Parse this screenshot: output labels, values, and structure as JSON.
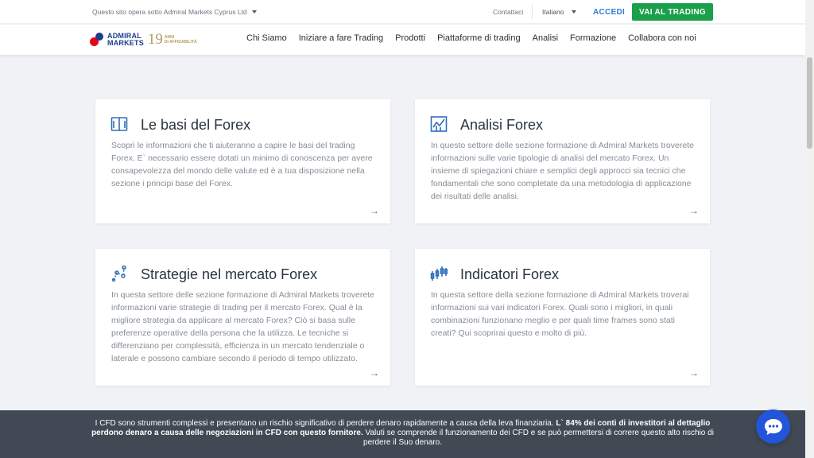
{
  "topbar": {
    "entity_text": "Questo sito opera sotto Admiral Markets Cyprus Ltd",
    "contact": "Contattaci",
    "language": "Italiano",
    "login": "ACCEDI",
    "cta": "VAI AL TRADING"
  },
  "logo": {
    "line1": "ADMIRAL",
    "line2": "MARKETS",
    "years": "19",
    "sub1": "ANNI",
    "sub2": "DI AFFIDABILITÀ"
  },
  "nav": {
    "items": [
      "Chi Siamo",
      "Iniziare a fare Trading",
      "Prodotti",
      "Piattaforme di trading",
      "Analisi",
      "Formazione",
      "Collabora con noi"
    ]
  },
  "cards": [
    {
      "title": "Le basi del Forex",
      "icon": "book-icon",
      "text": "Scopri le informazioni che ti aiuteranno a capire le basi del trading Forex. E` necessario essere dotati un minimo di conoscenza per avere consapevolezza del mondo delle valute ed è a tua disposizione nella sezione i principi base del Forex."
    },
    {
      "title": "Analisi Forex",
      "icon": "chart-analysis-icon",
      "text": "In questo settore delle sezione formazione di Admiral Markets troverete informazioni sulle varie tipologie di analisi del mercato Forex. Un insieme di spiegazioni chiare e semplici degli approcci sia tecnici che fondamentali che sono completate da una metodologia di applicazione dei risultati delle analisi."
    },
    {
      "title": "Strategie nel mercato Forex",
      "icon": "strategy-icon",
      "text": "In questa settore delle sezione formazione di Admiral Markets troverete informazioni varie strategie di trading per il mercato Forex. Qual è la migliore strategia da applicare al mercato Forex? Ciò si basa sulle preferenze operative della persona che la utilizza. Le tecniche si differenziano per complessità, efficienza in un mercato tendenziale o laterale e possono cambiare secondo il periodo di tempo utilizzato."
    },
    {
      "title": "Indicatori Forex",
      "icon": "candlestick-icon",
      "text": "In questa settore della sezione formazione di Admiral Markets troverai informazioni sui vari indicatori Forex. Quali sono i migliori, in quali combinazioni funzionano meglio e per quali time frames sono stati creati? Qui scoprirai questo e molto di più."
    }
  ],
  "card_arrow": "→",
  "banner": {
    "part1": "I CFD sono strumenti complessi e presentano un rischio significativo di perdere denaro rapidamente a causa della leva finanziaria. ",
    "bold": "L` 84% dei conti di investitori al dettaglio perdono denaro a causa delle negoziazioni in CFD con questo fornitore.",
    "part2": " Valuti se comprende il funzionamento dei CFD e se può permettersi di correre questo alto rischio di perdere il Suo denaro."
  },
  "colors": {
    "accent_blue": "#2d7bd3",
    "cta_green": "#1aa04b",
    "brand_navy": "#1c3c8c",
    "brand_red": "#e30613",
    "icon_blue": "#2f6fb8"
  }
}
